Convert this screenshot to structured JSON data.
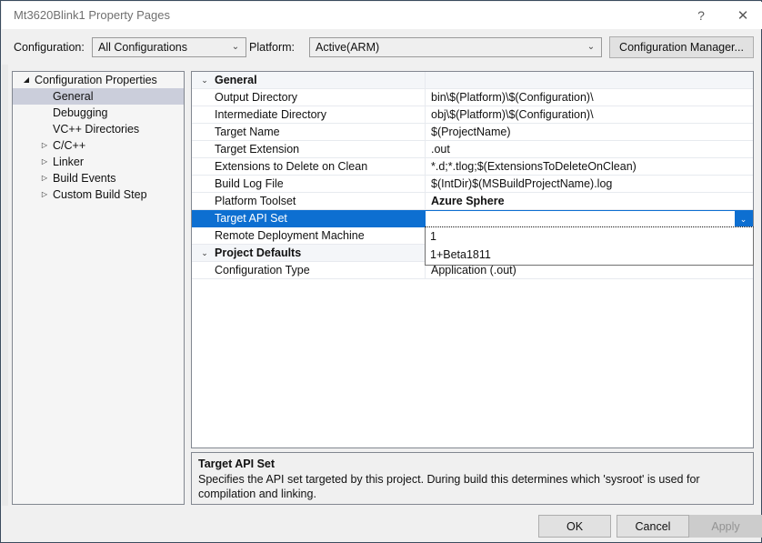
{
  "window": {
    "title": "Mt3620Blink1 Property Pages",
    "help_icon": "?",
    "close_icon": "✕"
  },
  "configbar": {
    "configuration_label": "Configuration:",
    "configuration_value": "All Configurations",
    "platform_label": "Platform:",
    "platform_value": "Active(ARM)",
    "config_manager_label": "Configuration Manager...",
    "chevron_icon": "⌄"
  },
  "tree": {
    "items": [
      {
        "label": "Configuration Properties",
        "depth": 0,
        "expander": "◢",
        "selected": false
      },
      {
        "label": "General",
        "depth": 1,
        "expander": "",
        "selected": true
      },
      {
        "label": "Debugging",
        "depth": 1,
        "expander": "",
        "selected": false
      },
      {
        "label": "VC++ Directories",
        "depth": 1,
        "expander": "",
        "selected": false
      },
      {
        "label": "C/C++",
        "depth": 1,
        "expander": "▷",
        "selected": false
      },
      {
        "label": "Linker",
        "depth": 1,
        "expander": "▷",
        "selected": false
      },
      {
        "label": "Build Events",
        "depth": 1,
        "expander": "▷",
        "selected": false
      },
      {
        "label": "Custom Build Step",
        "depth": 1,
        "expander": "▷",
        "selected": false
      }
    ]
  },
  "grid": {
    "collapse_icon": "⌄",
    "dropdown_icon": "⌄",
    "rows": [
      {
        "kind": "category",
        "name": "General",
        "value": "",
        "selected": false,
        "bold_value": false
      },
      {
        "kind": "prop",
        "name": "Output Directory",
        "value": "bin\\$(Platform)\\$(Configuration)\\",
        "selected": false,
        "bold_value": false
      },
      {
        "kind": "prop",
        "name": "Intermediate Directory",
        "value": "obj\\$(Platform)\\$(Configuration)\\",
        "selected": false,
        "bold_value": false
      },
      {
        "kind": "prop",
        "name": "Target Name",
        "value": "$(ProjectName)",
        "selected": false,
        "bold_value": false
      },
      {
        "kind": "prop",
        "name": "Target Extension",
        "value": ".out",
        "selected": false,
        "bold_value": false
      },
      {
        "kind": "prop",
        "name": "Extensions to Delete on Clean",
        "value": "*.d;*.tlog;$(ExtensionsToDeleteOnClean)",
        "selected": false,
        "bold_value": false
      },
      {
        "kind": "prop",
        "name": "Build Log File",
        "value": "$(IntDir)$(MSBuildProjectName).log",
        "selected": false,
        "bold_value": false
      },
      {
        "kind": "prop",
        "name": "Platform Toolset",
        "value": "Azure Sphere",
        "selected": false,
        "bold_value": true
      },
      {
        "kind": "prop",
        "name": "Target API Set",
        "value": "",
        "selected": true,
        "bold_value": false
      },
      {
        "kind": "prop",
        "name": "Remote Deployment Machine",
        "value": "",
        "selected": false,
        "bold_value": false
      },
      {
        "kind": "category",
        "name": "Project Defaults",
        "value": "",
        "selected": false,
        "bold_value": false
      },
      {
        "kind": "prop",
        "name": "Configuration Type",
        "value": "Application (.out)",
        "selected": false,
        "bold_value": false
      }
    ]
  },
  "dropdown": {
    "options": [
      "1",
      "1+Beta1811"
    ]
  },
  "description": {
    "title": "Target API Set",
    "body": "Specifies the API set targeted by this project. During build this determines which 'sysroot' is used for compilation and linking."
  },
  "footer": {
    "ok_label": "OK",
    "cancel_label": "Cancel",
    "apply_label": "Apply"
  },
  "colors": {
    "selection_blue": "#0d6fd1",
    "tree_selection": "#cbcedb",
    "window_border": "#3b4c5e",
    "panel_border": "#828790"
  }
}
